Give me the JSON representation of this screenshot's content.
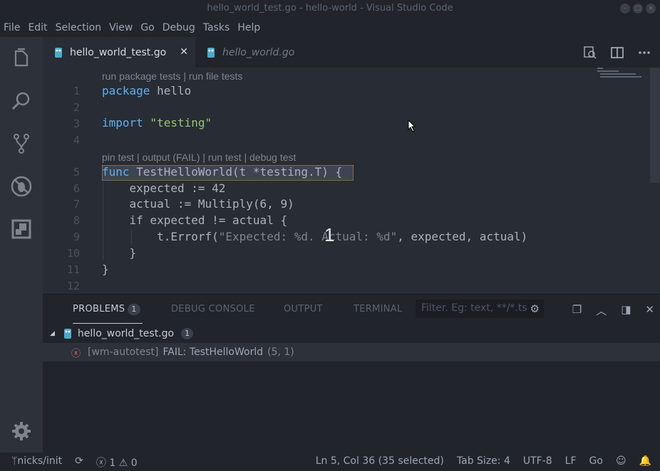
{
  "window": {
    "title": "hello_world_test.go - hello-world - Visual Studio Code"
  },
  "menu": [
    "File",
    "Edit",
    "Selection",
    "View",
    "Go",
    "Debug",
    "Tasks",
    "Help"
  ],
  "tabs": [
    {
      "label": "hello_world_test.go",
      "close": "✕"
    },
    {
      "label": "hello_world.go"
    }
  ],
  "editor": {
    "codelens_top": "run package tests | run file tests",
    "codelens_func": "pin test | output (FAIL) | run test | debug test",
    "line_numbers": [
      "1",
      "2",
      "3",
      "4",
      "5",
      "6",
      "7",
      "8",
      "9",
      "10",
      "11",
      "12"
    ],
    "lines": {
      "l1_kw": "package",
      "l1_rest": " hello",
      "l3_kw": "import",
      "l3_str": " \"testing\"",
      "l5_kw": "func",
      "l5_rest": " TestHelloWorld(t *testing.T) {",
      "l6": "    expected := 42",
      "l7": "    actual := Multiply(6, 9)",
      "l8": "    if expected != actual {",
      "l9_a": "        t.Errorf(",
      "l9_str": "\"Expected: %d. Actual: %d\"",
      "l9_b": ", expected, actual)",
      "l10": "    }",
      "l11": "}"
    },
    "overlay_text": "1"
  },
  "panel": {
    "tabs": [
      {
        "label": "PROBLEMS",
        "badge": "1"
      },
      {
        "label": "DEBUG CONSOLE"
      },
      {
        "label": "OUTPUT"
      },
      {
        "label": "TERMINAL"
      }
    ],
    "filter_placeholder": "Filter. Eg: text, **/*.ts",
    "file": {
      "name": "hello_world_test.go",
      "count": "1"
    },
    "problem": {
      "source": "[wm-autotest]",
      "message": "FAIL: TestHelloWorld",
      "position": "(5, 1)"
    }
  },
  "status": {
    "branch": "nicks/init",
    "errors": "1",
    "warnings": "0",
    "cursor": "Ln 5, Col 36 (35 selected)",
    "tab_size": "Tab Size: 4",
    "encoding": "UTF-8",
    "eol": "LF",
    "language": "Go"
  },
  "colors": {
    "accent": "#61afef",
    "error": "#e06c75",
    "string": "#98c379"
  }
}
